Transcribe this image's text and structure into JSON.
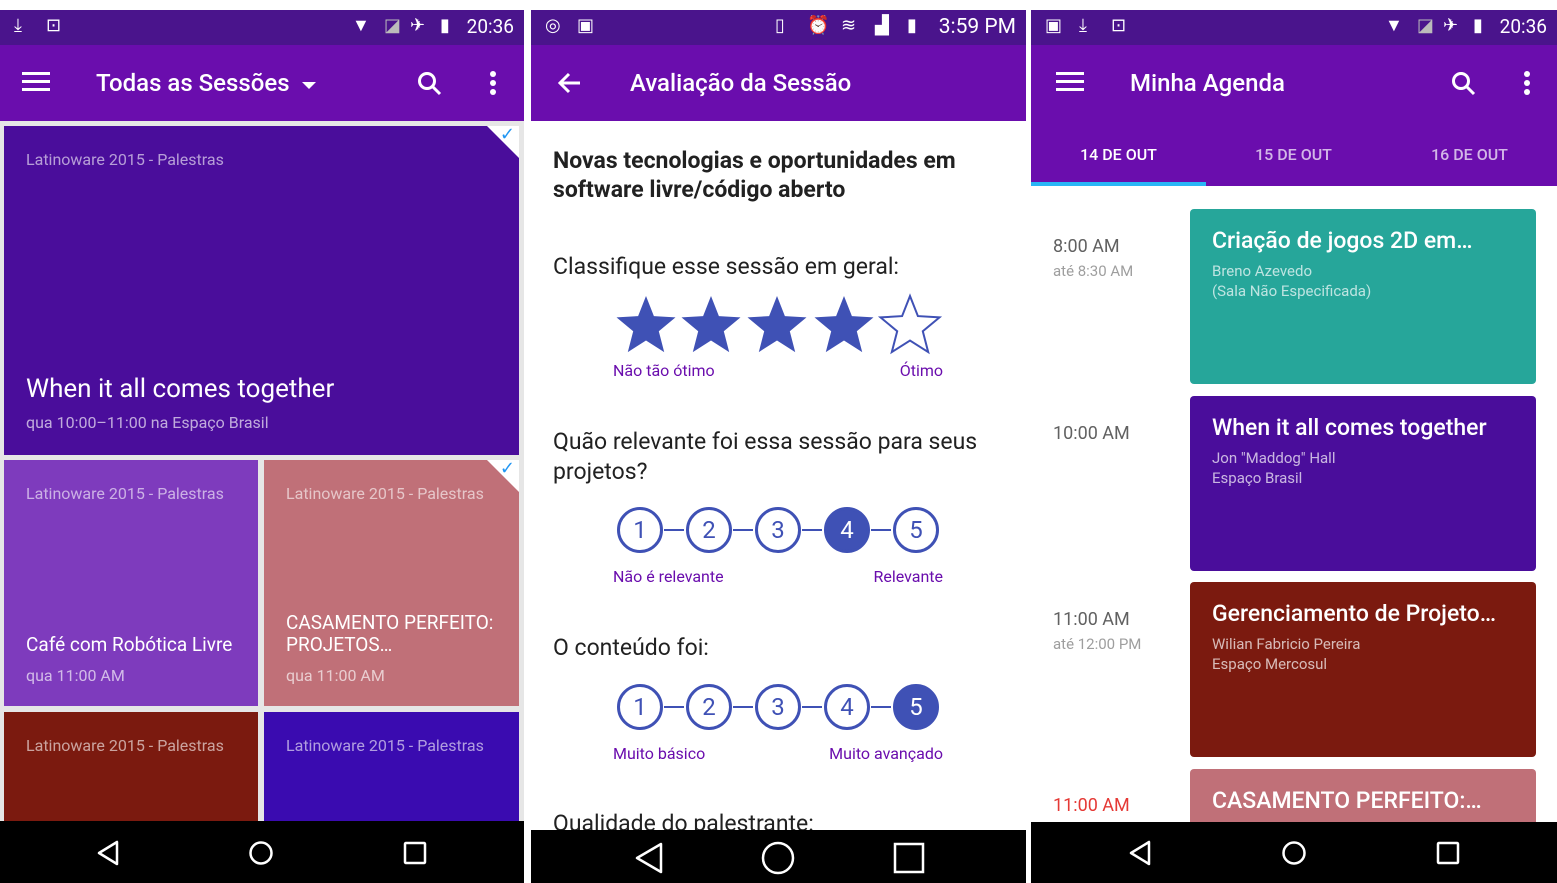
{
  "colors": {
    "status_bar": "#4a148c",
    "app_bar": "#6a0dad",
    "accent_blue": "#3f51b5",
    "check_blue": "#2196f3",
    "tab_indicator": "#29b6f6"
  },
  "screen1": {
    "status": {
      "time": "20:36",
      "icons": [
        "download-icon",
        "save-icon",
        "wifi-icon",
        "no-sim-icon",
        "airplane-icon",
        "battery-icon"
      ]
    },
    "app_bar": {
      "title": "Todas as Sessões",
      "icons": [
        "menu-icon",
        "dropdown-icon",
        "search-icon",
        "more-icon"
      ]
    },
    "cards": [
      {
        "category": "Latinoware 2015 - Palestras",
        "title": "When it all comes together",
        "meta": "qua 10:00–11:00 na Espaço Brasil",
        "color": "#4a0d9b",
        "starred": true
      },
      {
        "category": "Latinoware 2015 - Palestras",
        "title": "Café com Robótica Livre",
        "meta": "qua 11:00 AM",
        "color": "#7e3bbd",
        "starred": false
      },
      {
        "category": "Latinoware 2015 - Palestras",
        "title": "CASAMENTO PERFEITO: PROJETOS…",
        "meta": "qua 11:00 AM",
        "color": "#c07078",
        "starred": true
      },
      {
        "category": "Latinoware 2015 - Palestras",
        "color": "#7b1a0f"
      },
      {
        "category": "Latinoware 2015 - Palestras",
        "color": "#3a0bb0"
      }
    ]
  },
  "screen2": {
    "status": {
      "time": "3:59 PM",
      "icons": [
        "whatsapp-icon",
        "image-icon",
        "vibrate-icon",
        "alarm-icon",
        "wifi-icon",
        "signal-icon",
        "battery-charging-icon"
      ]
    },
    "app_bar": {
      "title": "Avaliação da Sessão",
      "icons": [
        "back-arrow-icon"
      ]
    },
    "session_title": "Novas tecnologias e oportunidades em software livre/código aberto",
    "questions": [
      {
        "text": "Classifique esse sessão em geral:",
        "type": "stars",
        "value": 4,
        "max": 5,
        "low": "Não tão ótimo",
        "high": "Ótimo"
      },
      {
        "text": "Quão relevante foi essa sessão para seus projetos?",
        "type": "scale",
        "options": [
          "1",
          "2",
          "3",
          "4",
          "5"
        ],
        "selected": "4",
        "low": "Não é relevante",
        "high": "Relevante"
      },
      {
        "text": "O conteúdo foi:",
        "type": "scale",
        "options": [
          "1",
          "2",
          "3",
          "4",
          "5"
        ],
        "selected": "5",
        "low": "Muito básico",
        "high": "Muito avançado"
      },
      {
        "text": "Qualidade do palestrante:"
      }
    ]
  },
  "screen3": {
    "status": {
      "time": "20:36",
      "icons": [
        "image-icon",
        "download-icon",
        "save-icon",
        "wifi-icon",
        "no-sim-icon",
        "airplane-icon",
        "battery-icon"
      ]
    },
    "app_bar": {
      "title": "Minha Agenda",
      "icons": [
        "menu-icon",
        "search-icon",
        "more-icon"
      ]
    },
    "tabs": [
      {
        "label": "14 DE OUT",
        "active": true
      },
      {
        "label": "15 DE OUT",
        "active": false
      },
      {
        "label": "16 DE OUT",
        "active": false
      }
    ],
    "items": [
      {
        "time": "8:00 AM",
        "end": "até 8:30 AM",
        "title": "Criação de jogos 2D em…",
        "line1": "Breno Azevedo",
        "line2": "(Sala Não Especificada)",
        "color": "#26a69a"
      },
      {
        "time": "10:00 AM",
        "end": "",
        "title": "When it all comes together",
        "line1": "Jon \"Maddog\" Hall",
        "line2": "Espaço Brasil",
        "color": "#4a0d9b"
      },
      {
        "time": "11:00 AM",
        "end": "até 12:00 PM",
        "title": "Gerenciamento de Projeto…",
        "line1": "Wilian Fabricio Pereira",
        "line2": "Espaço Mercosul",
        "color": "#7b1a0f"
      },
      {
        "time": "11:00 AM",
        "end": "",
        "title": "CASAMENTO PERFEITO:…",
        "line1": "",
        "line2": "",
        "color": "#c07078",
        "time_color": "#e53935"
      }
    ]
  },
  "nav": {
    "icons": [
      "back-nav-icon",
      "home-nav-icon",
      "recents-nav-icon"
    ]
  }
}
